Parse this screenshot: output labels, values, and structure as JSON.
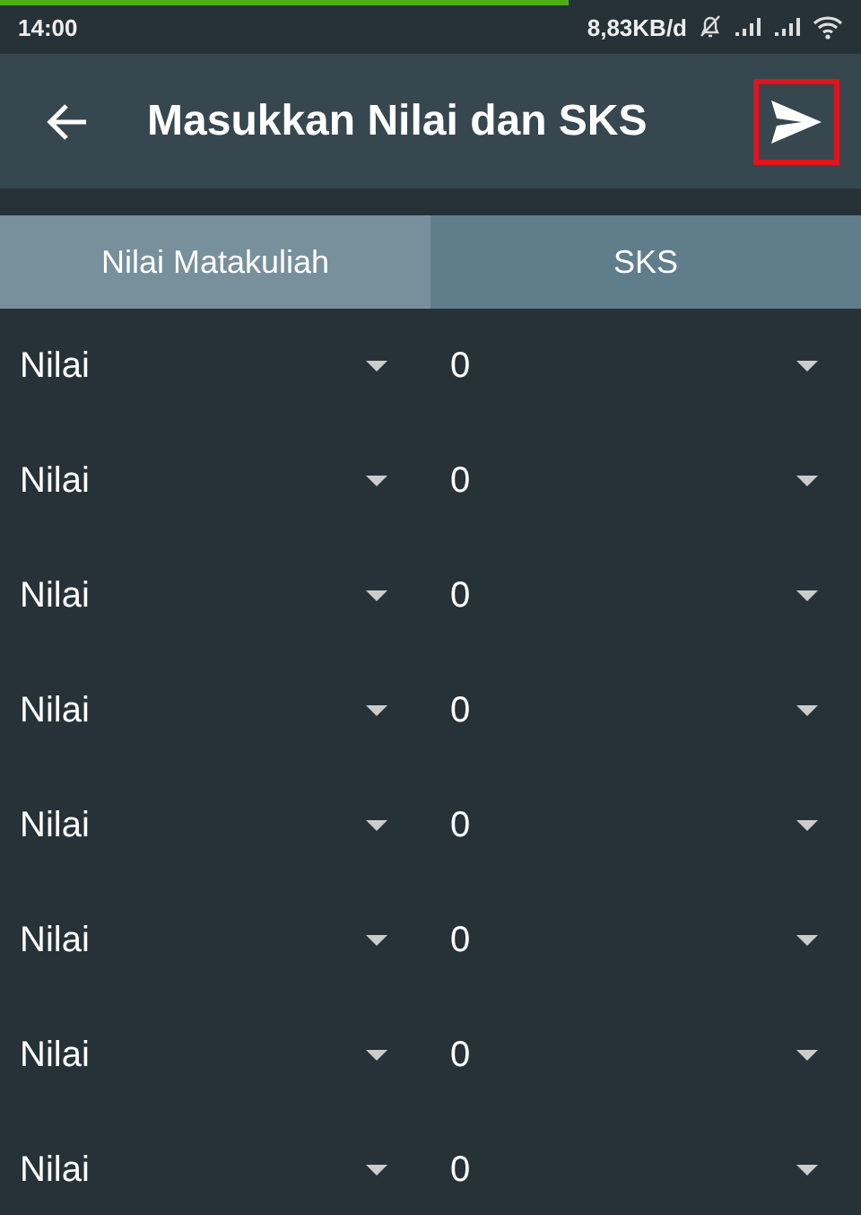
{
  "status_bar": {
    "time": "14:00",
    "speed": "8,83KB/d",
    "progress": {
      "level": 0.66
    }
  },
  "app_bar": {
    "title": "Masukkan Nilai dan SKS",
    "send_highlighted": true
  },
  "columns": [
    {
      "label": "Nilai Matakuliah",
      "color": "#78909c"
    },
    {
      "label": "SKS",
      "color": "#607d8b"
    }
  ],
  "rows": [
    {
      "grade": "Nilai",
      "credits": "0"
    },
    {
      "grade": "Nilai",
      "credits": "0"
    },
    {
      "grade": "Nilai",
      "credits": "0"
    },
    {
      "grade": "Nilai",
      "credits": "0"
    },
    {
      "grade": "Nilai",
      "credits": "0"
    },
    {
      "grade": "Nilai",
      "credits": "0"
    },
    {
      "grade": "Nilai",
      "credits": "0"
    },
    {
      "grade": "Nilai",
      "credits": "0"
    }
  ]
}
